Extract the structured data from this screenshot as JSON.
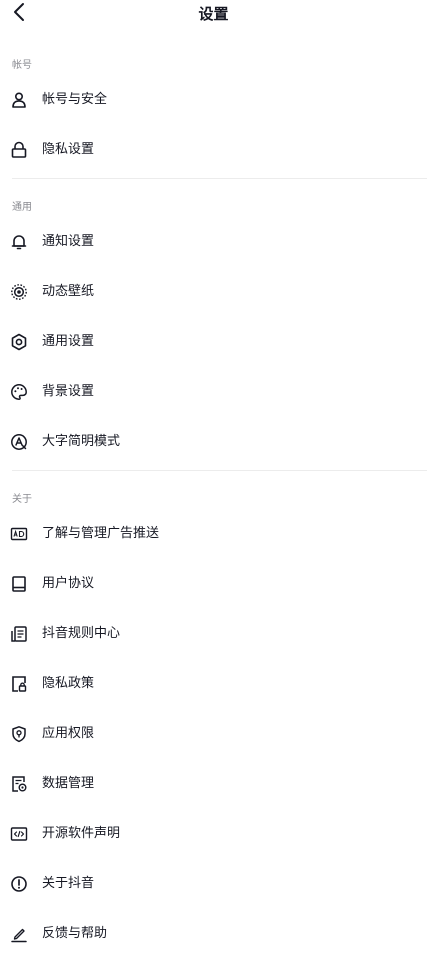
{
  "header": {
    "title": "设置"
  },
  "sections": [
    {
      "label": "帐号",
      "items": [
        {
          "label": "帐号与安全",
          "icon": "user-icon"
        },
        {
          "label": "隐私设置",
          "icon": "lock-icon"
        }
      ]
    },
    {
      "label": "通用",
      "items": [
        {
          "label": "通知设置",
          "icon": "bell-icon"
        },
        {
          "label": "动态壁纸",
          "icon": "wallpaper-icon"
        },
        {
          "label": "通用设置",
          "icon": "gear-icon"
        },
        {
          "label": "背景设置",
          "icon": "palette-icon"
        },
        {
          "label": "大字简明模式",
          "icon": "large-font-icon"
        }
      ]
    },
    {
      "label": "关于",
      "items": [
        {
          "label": "了解与管理广告推送",
          "icon": "ad-icon"
        },
        {
          "label": "用户协议",
          "icon": "book-icon"
        },
        {
          "label": "抖音规则中心",
          "icon": "rules-icon"
        },
        {
          "label": "隐私政策",
          "icon": "privacy-doc-icon"
        },
        {
          "label": "应用权限",
          "icon": "shield-icon"
        },
        {
          "label": "数据管理",
          "icon": "data-icon"
        },
        {
          "label": "开源软件声明",
          "icon": "code-icon"
        },
        {
          "label": "关于抖音",
          "icon": "info-icon"
        },
        {
          "label": "反馈与帮助",
          "icon": "pen-icon"
        }
      ]
    }
  ]
}
